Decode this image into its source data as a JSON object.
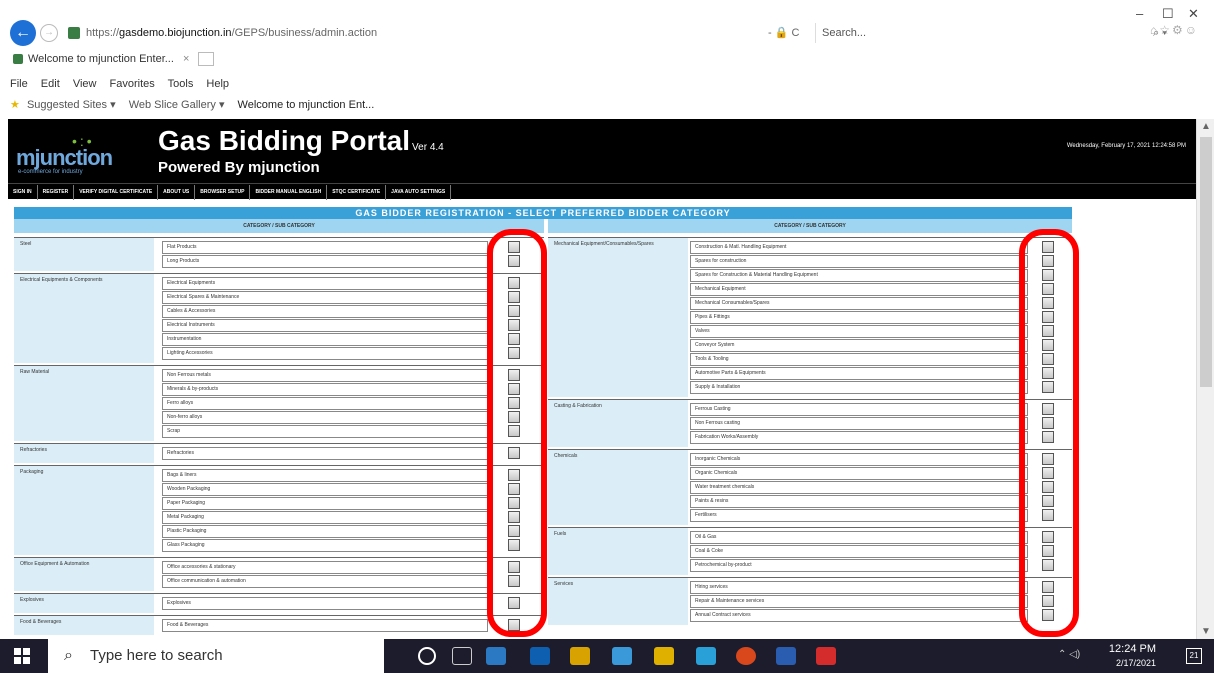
{
  "browser": {
    "url_prefix": "https://",
    "url_domain": "gasdemo.biojunction.in",
    "url_path": "/GEPS/business/admin.action",
    "url_tools": "- 🔒 C",
    "search_placeholder": "Search...",
    "tab_title": "Welcome to mjunction Enter...",
    "menu": [
      "File",
      "Edit",
      "View",
      "Favorites",
      "Tools",
      "Help"
    ],
    "favorites": [
      "Suggested Sites ▾",
      "Web Slice Gallery ▾",
      "Welcome to mjunction Ent..."
    ]
  },
  "site": {
    "logo_name": "mjunction",
    "logo_tag": "e-commerce for industry",
    "title": "Gas Bidding Portal",
    "version": "Ver 4.4",
    "subtitle": "Powered By mjunction",
    "date": "Wednesday, February 17, 2021  12:24:58 PM",
    "nav": [
      "SIGN IN",
      "REGISTER",
      "VERIFY DIGITAL CERTIFICATE",
      "ABOUT US",
      "BROWSER SETUP",
      "BIDDER MANUAL ENGLISH",
      "STQC CERTIFICATE",
      "JAVA AUTO SETTINGS"
    ],
    "page_title": "GAS  BIDDER  REGISTRATION  -  SELECT  PREFERRED  BIDDER  CATEGORY",
    "col_head": "CATEGORY / SUB CATEGORY"
  },
  "left_groups": [
    {
      "name": "Steel",
      "items": [
        "Flat Products",
        "Long Products"
      ]
    },
    {
      "name": "Electrical Equipments & Components",
      "items": [
        "Electrical Equipments",
        "Electrical Spares & Maintenance",
        "Cables & Accessories",
        "Electrical Instruments",
        "Instrumentation",
        "Lighting Accessories"
      ]
    },
    {
      "name": "Raw Material",
      "items": [
        "Non Ferrous metals",
        "Minerals & by-products",
        "Ferro alloys",
        "Non-ferro alloys",
        "Scrap"
      ]
    },
    {
      "name": "Refractories",
      "items": [
        "Refractories"
      ]
    },
    {
      "name": "Packaging",
      "items": [
        "Bags & liners",
        "Wooden Packaging",
        "Paper Packaging",
        "Metal Packaging",
        "Plastic Packaging",
        "Glass Packaging"
      ]
    },
    {
      "name": "Office Equipment & Automation",
      "items": [
        "Office accessories & stationary",
        "Office communication & automation"
      ]
    },
    {
      "name": "Explosives",
      "items": [
        "Explosives"
      ]
    },
    {
      "name": "Food & Beverages",
      "items": [
        "Food & Beverages"
      ]
    }
  ],
  "right_groups": [
    {
      "name": "Mechanical Equipment/Consumables/Spares",
      "items": [
        "Construction & Matl. Handling Equipment",
        "Spares for construction",
        "Spares for Construction & Material Handling Equipment",
        "Mechanical Equipment",
        "Mechanical Consumables/Spares",
        "Pipes & Fittings",
        "Valves",
        "Conveyor System",
        "Tools & Tooling",
        "Automotive Parts & Equipments",
        "Supply & Installation"
      ]
    },
    {
      "name": "Casting & Fabrication",
      "items": [
        "Ferrous Casting",
        "Non Ferrous casting",
        "Fabrication Works/Assembly"
      ]
    },
    {
      "name": "Chemicals",
      "items": [
        "Inorganic Chemicals",
        "Organic Chemicals",
        "Water treatment chemicals",
        "Paints & resins",
        "Fertilisers"
      ]
    },
    {
      "name": "Fuels",
      "items": [
        "Oil & Gas",
        "Coal & Coke",
        "Petrochemical by-product"
      ]
    },
    {
      "name": "Services",
      "items": [
        "Hiring services",
        "Repair & Maintenance services",
        "Annual Contract services"
      ]
    }
  ],
  "taskbar": {
    "search_placeholder": "Type here to search",
    "time": "12:24 PM",
    "date": "2/17/2021",
    "notif": "21"
  },
  "colors": {
    "header_bg": "#000000",
    "title_bar": "#3aa0d8",
    "col_head": "#9fd5f0",
    "group_bg": "#dbeef7",
    "highlight": "#ff0000"
  }
}
